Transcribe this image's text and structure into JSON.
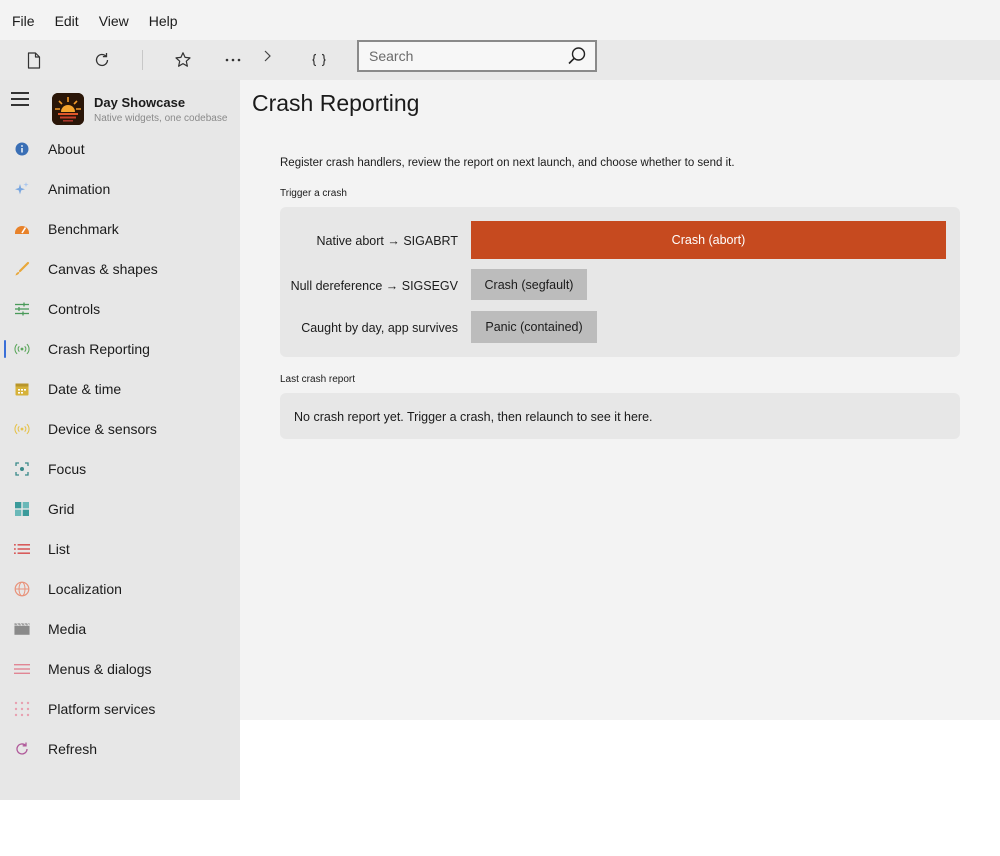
{
  "menubar": {
    "items": [
      "File",
      "Edit",
      "View",
      "Help"
    ]
  },
  "toolbar": {
    "icons": [
      "new-file-icon",
      "refresh-icon",
      "star-icon",
      "more-icon",
      "chevron-right-icon",
      "code-braces-icon"
    ],
    "search": {
      "placeholder": "Search",
      "value": ""
    }
  },
  "app": {
    "title": "Day Showcase",
    "subtitle": "Native widgets, one codebase"
  },
  "sidebar": {
    "items": [
      {
        "label": "About",
        "icon": "info-icon",
        "color": "#3a6fb5"
      },
      {
        "label": "Animation",
        "icon": "sparkle-icon",
        "color": "#7aa7e0"
      },
      {
        "label": "Benchmark",
        "icon": "gauge-icon",
        "color": "#e8822a"
      },
      {
        "label": "Canvas & shapes",
        "icon": "brush-icon",
        "color": "#e8a73a"
      },
      {
        "label": "Controls",
        "icon": "sliders-icon",
        "color": "#4a9a5a"
      },
      {
        "label": "Crash Reporting",
        "icon": "broadcast-icon",
        "color": "#5aa65a",
        "selected": true
      },
      {
        "label": "Date & time",
        "icon": "calendar-icon",
        "color": "#d6b23a"
      },
      {
        "label": "Device & sensors",
        "icon": "sensor-icon",
        "color": "#e6c24a"
      },
      {
        "label": "Focus",
        "icon": "focus-icon",
        "color": "#3a8a8a"
      },
      {
        "label": "Grid",
        "icon": "grid-icon",
        "color": "#3a9a9a"
      },
      {
        "label": "List",
        "icon": "list-icon",
        "color": "#d64a4a"
      },
      {
        "label": "Localization",
        "icon": "globe-icon",
        "color": "#e8927a"
      },
      {
        "label": "Media",
        "icon": "clapper-icon",
        "color": "#8a8a8a"
      },
      {
        "label": "Menus & dialogs",
        "icon": "menu-lines-icon",
        "color": "#e07a8a"
      },
      {
        "label": "Platform services",
        "icon": "dots-grid-icon",
        "color": "#e8a0b0"
      },
      {
        "label": "Refresh",
        "icon": "refresh-circle-icon",
        "color": "#b05a9a"
      }
    ]
  },
  "main": {
    "title": "Crash Reporting",
    "description": "Register crash handlers, review the report on next launch, and choose whether to send it.",
    "trigger_section": {
      "label": "Trigger a crash",
      "rows": [
        {
          "label": "Native abort → SIGABRT",
          "button": "Crash (abort)"
        },
        {
          "label": "Null dereference → SIGSEGV",
          "button": "Crash (segfault)"
        },
        {
          "label": "Caught by day, app survives",
          "button": "Panic (contained)"
        }
      ]
    },
    "report_section": {
      "label": "Last crash report",
      "text": "No crash report yet. Trigger a crash, then relaunch to see it here."
    }
  },
  "colors": {
    "accent": "#c64a1f",
    "selection_indicator": "#3a6fd8"
  }
}
